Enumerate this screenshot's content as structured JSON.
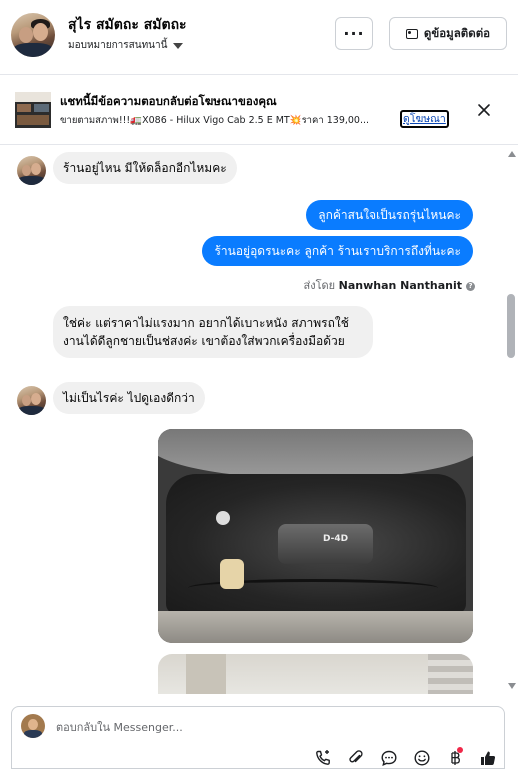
{
  "header": {
    "name": "สุไร สมัตถะ สมัตถะ",
    "assign_label": "มอบหมายการสนทนานี้",
    "more_label": "···",
    "contact_button": "ดูข้อมูลติดต่อ"
  },
  "ad_banner": {
    "title": "แชทนี้มีข้อความตอบกลับต่อโฆษณาของคุณ",
    "desc_part1": "ขายตามสภาพ!!! ",
    "desc_truck_emoji": "🚛",
    "desc_part2": " X086 - Hilux Vigo Cab 2.5 E MT ",
    "desc_spark_emoji": "💥",
    "desc_part3": " ราคา 139,00...",
    "link_label": "ดูโฆษณา"
  },
  "messages": [
    {
      "direction": "in",
      "text": "ร้านอยู่ไหน มีให้ดล็อกอีกไหมคะ"
    },
    {
      "direction": "out",
      "text": "ลูกค้าสนใจเป็นรถรุ่นไหนคะ"
    },
    {
      "direction": "out",
      "text": "ร้านอยู่อุดรนะคะ  ลูกค้า ร้านเราบริการถึงที่นะคะ"
    },
    {
      "direction": "in",
      "text": "ใช่ค่ะ แต่ราคาไม่แรงมาก อยากได้เบาะหนัง สภาพรถใช้งานได้ดีลูกชายเป็นช่สงค่ะ เขาต้องใส่พวกเครื่องมือด้วย"
    },
    {
      "direction": "in",
      "text": "ไม่เป็นไรค่ะ ไปดูเองดีกว่า"
    }
  ],
  "sent_by": {
    "prefix": "ส่งโดย ",
    "name": "Nanwhan Nanthanit",
    "info": "?"
  },
  "photo1_badge": "D-4D",
  "composer": {
    "placeholder": "ตอบกลับใน Messenger..."
  },
  "icons": {
    "header_more": "more-horizontal-icon",
    "contact_card": "contact-card-icon",
    "close": "close-icon",
    "tools": [
      "call-icon",
      "attach-icon",
      "chat-bubble-icon",
      "emoji-icon",
      "baht-icon",
      "like-icon"
    ]
  },
  "colors": {
    "accent": "#0a7cff",
    "incoming_bubble": "#f0f0f0",
    "notification": "#f02849"
  }
}
